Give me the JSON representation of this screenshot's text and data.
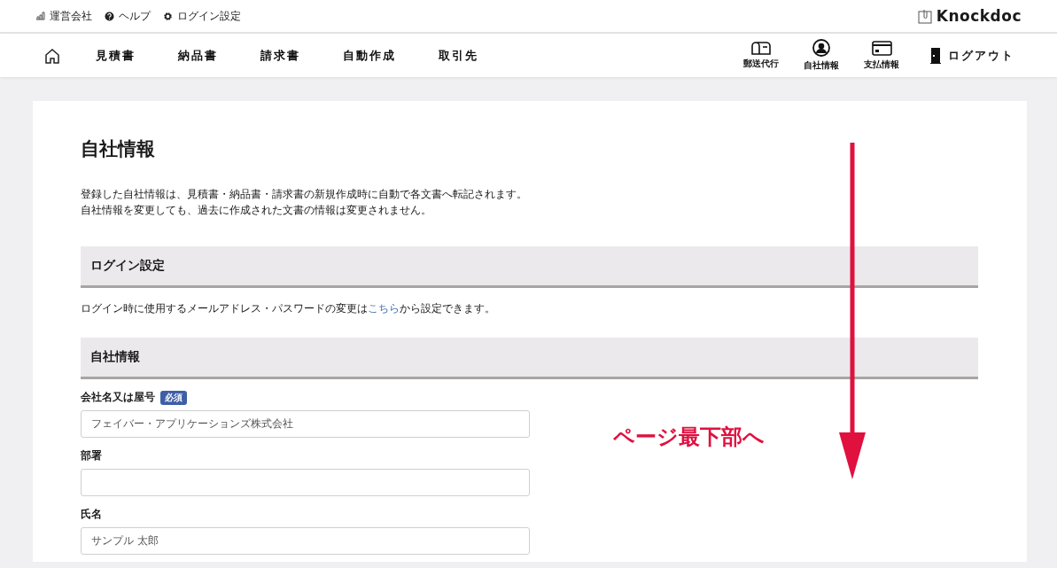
{
  "top_links": [
    {
      "kind": "building",
      "label": "運営会社"
    },
    {
      "kind": "help",
      "label": "ヘルプ"
    },
    {
      "kind": "gear",
      "label": "ログイン設定"
    }
  ],
  "logo": "Knockdoc",
  "nav": {
    "items": [
      "見積書",
      "納品書",
      "請求書",
      "自動作成",
      "取引先"
    ],
    "icon_items": [
      {
        "kind": "mail",
        "label": "郵送代行"
      },
      {
        "kind": "person",
        "label": "自社情報"
      },
      {
        "kind": "card",
        "label": "支払情報"
      }
    ],
    "logout": "ログアウト"
  },
  "page": {
    "title": "自社情報",
    "intro": [
      "登録した自社情報は、見積書・納品書・請求書の新規作成時に自動で各文書へ転記されます。",
      "自社情報を変更しても、過去に作成された文書の情報は変更されません。"
    ],
    "login_section": {
      "heading": "ログイン設定",
      "text_before": "ログイン時に使用するメールアドレス・パスワードの変更は",
      "link": "こちら",
      "text_after": "から設定できます。"
    },
    "company_section": {
      "heading": "自社情報",
      "fields": [
        {
          "label": "会社名又は屋号",
          "badge": "必須",
          "value": "フェイバー・アプリケーションズ株式会社"
        },
        {
          "label": "部署"
        },
        {
          "label": "氏名",
          "value": "サンプル 太郎"
        }
      ]
    }
  },
  "annotation": {
    "text": "ページ最下部へ"
  }
}
